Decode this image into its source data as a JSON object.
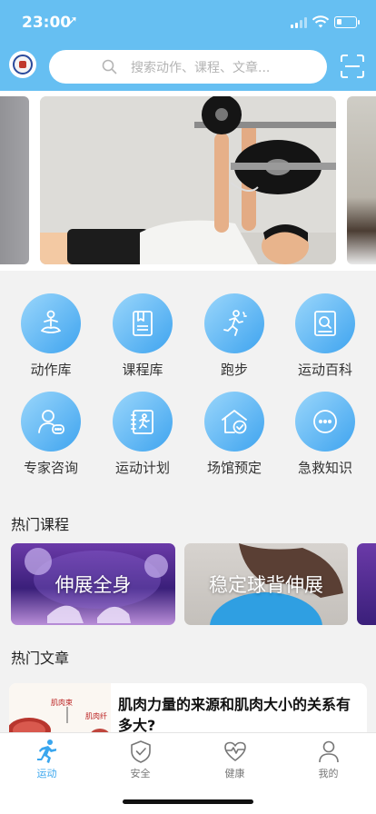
{
  "status_bar": {
    "time": "23:00",
    "location_glyph": "➚"
  },
  "header": {
    "logo_icon": "school-emblem",
    "search_placeholder": "搜索动作、课程、文章...",
    "scan_icon": "scan-icon"
  },
  "banner": {
    "slide_count": 5,
    "active_slide": 1,
    "image": "person doing barbell bench press"
  },
  "grid": [
    {
      "label": "动作库",
      "icon": "meditation-icon"
    },
    {
      "label": "课程库",
      "icon": "book-icon"
    },
    {
      "label": "跑步",
      "icon": "running-icon"
    },
    {
      "label": "运动百科",
      "icon": "encyclopedia-icon"
    },
    {
      "label": "专家咨询",
      "icon": "consult-icon"
    },
    {
      "label": "运动计划",
      "icon": "plan-icon"
    },
    {
      "label": "场馆预定",
      "icon": "venue-icon"
    },
    {
      "label": "急救知识",
      "icon": "first-aid-icon"
    }
  ],
  "hot_courses": {
    "title": "热门课程",
    "items": [
      {
        "title": "伸展全身"
      },
      {
        "title": "稳定球背伸展"
      }
    ]
  },
  "hot_articles": {
    "title": "热门文章",
    "items": [
      {
        "title": "肌肉力量的来源和肌肉大小的关系有多大?",
        "thumb_labels": [
          "肌肉束",
          "肌肉纤"
        ]
      }
    ]
  },
  "tabbar": [
    {
      "label": "运动",
      "icon": "sport-icon",
      "active": true
    },
    {
      "label": "安全",
      "icon": "shield-icon",
      "active": false
    },
    {
      "label": "健康",
      "icon": "heart-icon",
      "active": false
    },
    {
      "label": "我的",
      "icon": "user-icon",
      "active": false
    }
  ],
  "colors": {
    "header": "#66bff2",
    "accent": "#3aa6ee"
  }
}
